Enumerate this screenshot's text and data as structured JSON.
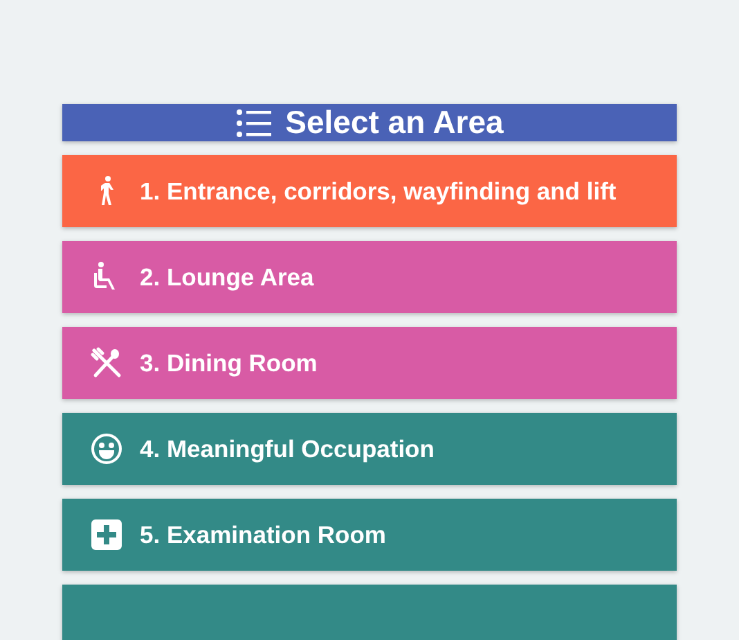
{
  "header": {
    "title": "Select an Area"
  },
  "areas": [
    {
      "label": "1. Entrance, corridors, wayfinding and lift",
      "color": "#fb6645"
    },
    {
      "label": "2. Lounge Area",
      "color": "#d85ba5"
    },
    {
      "label": "3. Dining Room",
      "color": "#d85ba5"
    },
    {
      "label": "4. Meaningful Occupation",
      "color": "#338a87"
    },
    {
      "label": "5. Examination Room",
      "color": "#338a87"
    },
    {
      "color": "#338a87"
    }
  ]
}
